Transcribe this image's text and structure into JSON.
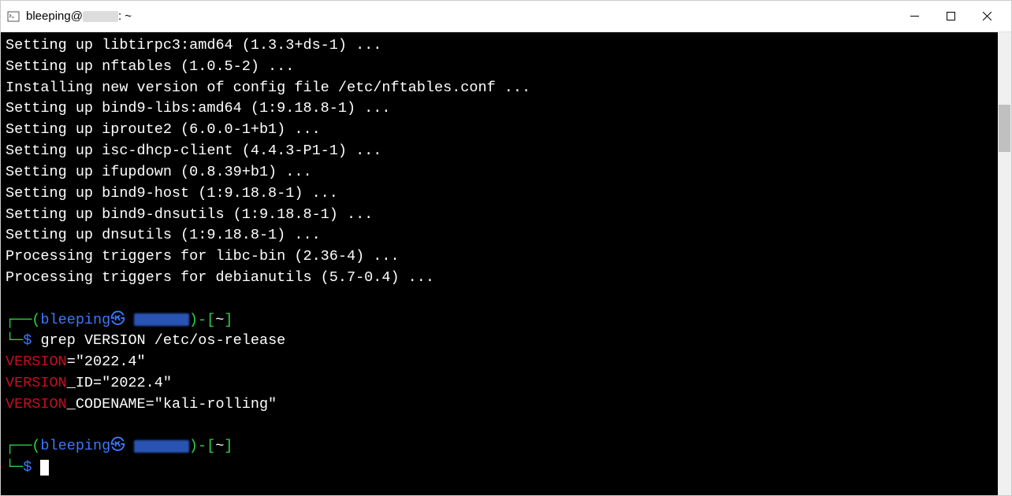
{
  "window": {
    "title_prefix": "bleeping@",
    "title_suffix": ": ~"
  },
  "terminal": {
    "output_lines": [
      "Setting up libtirpc3:amd64 (1.3.3+ds-1) ...",
      "Setting up nftables (1.0.5-2) ...",
      "Installing new version of config file /etc/nftables.conf ...",
      "Setting up bind9-libs:amd64 (1:9.18.8-1) ...",
      "Setting up iproute2 (6.0.0-1+b1) ...",
      "Setting up isc-dhcp-client (4.4.3-P1-1) ...",
      "Setting up ifupdown (0.8.39+b1) ...",
      "Setting up bind9-host (1:9.18.8-1) ...",
      "Setting up bind9-dnsutils (1:9.18.8-1) ...",
      "Setting up dnsutils (1:9.18.8-1) ...",
      "Processing triggers for libc-bin (2.36-4) ...",
      "Processing triggers for debianutils (5.7-0.4) ..."
    ],
    "prompt": {
      "user": "bleeping",
      "separator": "㉿",
      "path": "~",
      "symbol": "$"
    },
    "command1": "grep VERSION /etc/os-release",
    "grep_results": [
      {
        "match": "VERSION",
        "rest": "=\"2022.4\""
      },
      {
        "match": "VERSION",
        "rest": "_ID=\"2022.4\""
      },
      {
        "match": "VERSION",
        "rest": "_CODENAME=\"kali-rolling\""
      }
    ]
  }
}
